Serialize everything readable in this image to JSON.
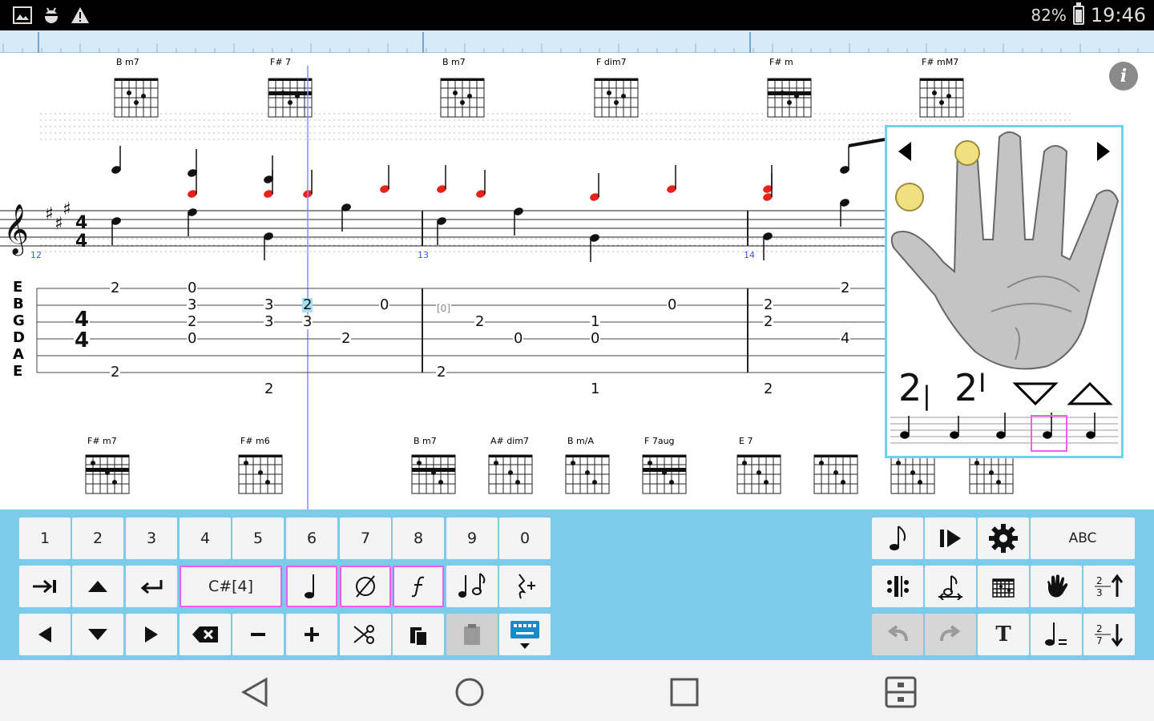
{
  "status_bar": {
    "icons": [
      "image-icon",
      "android-debug-icon",
      "warning-icon"
    ],
    "battery_percent": "82%",
    "battery_level": 0.82,
    "time": "19:46"
  },
  "score": {
    "top_chords": [
      {
        "name": "B m7"
      },
      {
        "name": "F# 7"
      },
      {
        "name": "B m7"
      },
      {
        "name": "F dim7"
      },
      {
        "name": "F# m"
      },
      {
        "name": "F# mM7"
      }
    ],
    "bottom_chords": [
      {
        "name": "F# m7"
      },
      {
        "name": "F# m6"
      },
      {
        "name": "B m7"
      },
      {
        "name": "A# dim7"
      },
      {
        "name": "B m/A"
      },
      {
        "name": "F 7aug"
      },
      {
        "name": "E 7"
      },
      {
        "name": ""
      },
      {
        "name": ""
      },
      {
        "name": ""
      }
    ],
    "measure_numbers": [
      "12",
      "13",
      "14"
    ],
    "tab_strings": [
      "E",
      "B",
      "G",
      "D",
      "A",
      "E"
    ],
    "time_signature": {
      "top": "4",
      "bottom": "4"
    },
    "frets": [
      {
        "s": 0,
        "m": 0,
        "v": "2"
      },
      {
        "s": 5,
        "m": 0,
        "v": "2"
      },
      {
        "s": 0,
        "m": 1,
        "v": "0"
      },
      {
        "s": 1,
        "m": 1,
        "v": "3"
      },
      {
        "s": 2,
        "m": 1,
        "v": "2"
      },
      {
        "s": 3,
        "m": 1,
        "v": "0"
      },
      {
        "s": 1,
        "m": 2,
        "v": "3"
      },
      {
        "s": 2,
        "m": 2,
        "v": "3"
      },
      {
        "s": 6,
        "m": 2,
        "v": "2"
      },
      {
        "s": 1,
        "m": 3,
        "v": "2"
      },
      {
        "s": 2,
        "m": 3,
        "v": "3"
      },
      {
        "s": 3,
        "m": 4,
        "v": "2"
      },
      {
        "s": 1,
        "m": 5,
        "v": "0"
      },
      {
        "s": 1,
        "m": 6,
        "v": "[0]"
      },
      {
        "s": 5,
        "m": 6,
        "v": "2"
      },
      {
        "s": 2,
        "m": 7,
        "v": "2"
      },
      {
        "s": 3,
        "m": 8,
        "v": "0"
      },
      {
        "s": 2,
        "m": 9,
        "v": "1"
      },
      {
        "s": 3,
        "m": 9,
        "v": "0"
      },
      {
        "s": 6,
        "m": 9,
        "v": "1"
      },
      {
        "s": 1,
        "m": 10,
        "v": "0"
      },
      {
        "s": 1,
        "m": 11,
        "v": "2"
      },
      {
        "s": 2,
        "m": 11,
        "v": "2"
      },
      {
        "s": 6,
        "m": 11,
        "v": "2"
      },
      {
        "s": 0,
        "m": 12,
        "v": "2"
      },
      {
        "s": 3,
        "m": 12,
        "v": "4"
      }
    ],
    "info_label": "i"
  },
  "hand_panel": {
    "finger_labels": [
      "2",
      "2"
    ],
    "string_markers": [
      "|",
      "I"
    ]
  },
  "keyboard": {
    "digits": [
      "1",
      "2",
      "3",
      "4",
      "5",
      "6",
      "7",
      "8",
      "9",
      "0"
    ],
    "note_name": "C#[4]",
    "abc_label": "ABC",
    "text_label": "T"
  },
  "colors": {
    "ruler": "#d6eaf8",
    "keyboard_bg": "#7ccbea",
    "selection_border": "#ee5ff0",
    "hand_panel_border": "#6fd1f0",
    "note_red": "#e8221b",
    "measure_blue": "#3a5bd9",
    "cursor_line": "#8a8aff"
  }
}
